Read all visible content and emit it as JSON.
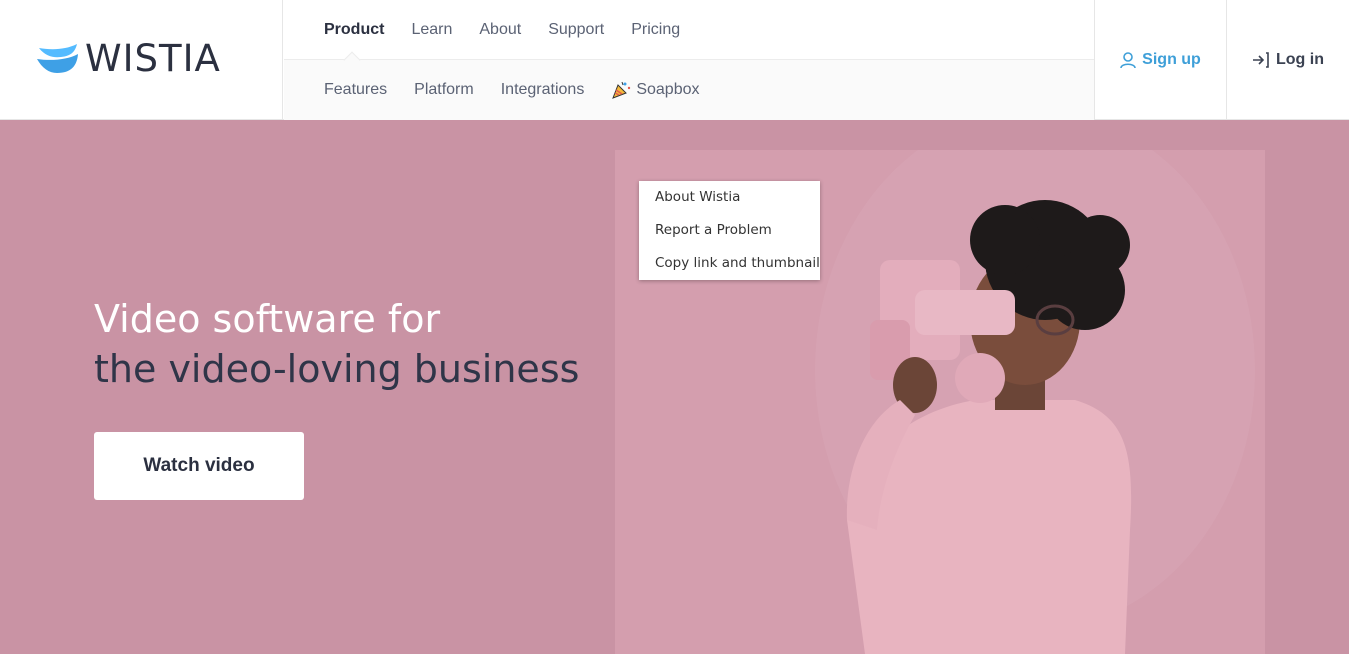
{
  "brand": {
    "name": "WISTIA",
    "accent": "#3e9fd8"
  },
  "nav": {
    "top": [
      "Product",
      "Learn",
      "About",
      "Support",
      "Pricing"
    ],
    "active": "Product",
    "sub": [
      "Features",
      "Platform",
      "Integrations",
      "Soapbox"
    ]
  },
  "account": {
    "signup": "Sign up",
    "login": "Log in"
  },
  "hero": {
    "line1": "Video software for",
    "line2": "the video-loving business",
    "cta": "Watch video",
    "background": "#c993a4"
  },
  "context_menu": {
    "items": [
      "About Wistia",
      "Report a Problem",
      "Copy link and thumbnail"
    ]
  },
  "icons": {
    "signup": "user-icon",
    "login": "login-arrow-icon",
    "soapbox": "party-popper-icon"
  }
}
